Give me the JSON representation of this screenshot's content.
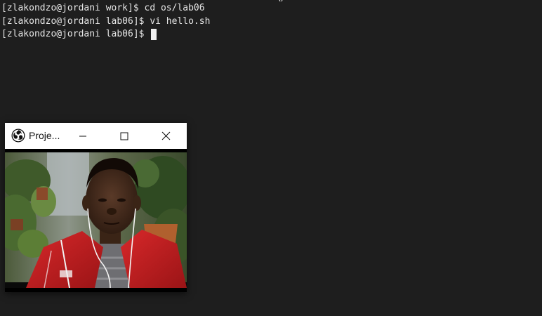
{
  "terminal": {
    "lines": [
      "[zlakondzo@jordani work]$ cd os/lab06",
      "[zlakondzo@jordani lab06]$ vi hello.sh",
      "[zlakondzo@jordani lab06]$ "
    ],
    "colors": {
      "background": "#1e1e1e",
      "text": "#e6e6e6",
      "cursor": "#f0f0f0"
    }
  },
  "projector_window": {
    "title": "Proje...",
    "icon": "obs-logo-icon",
    "controls": [
      "minimize-icon",
      "maximize-icon",
      "close-icon"
    ],
    "content": "webcam-video-feed"
  }
}
